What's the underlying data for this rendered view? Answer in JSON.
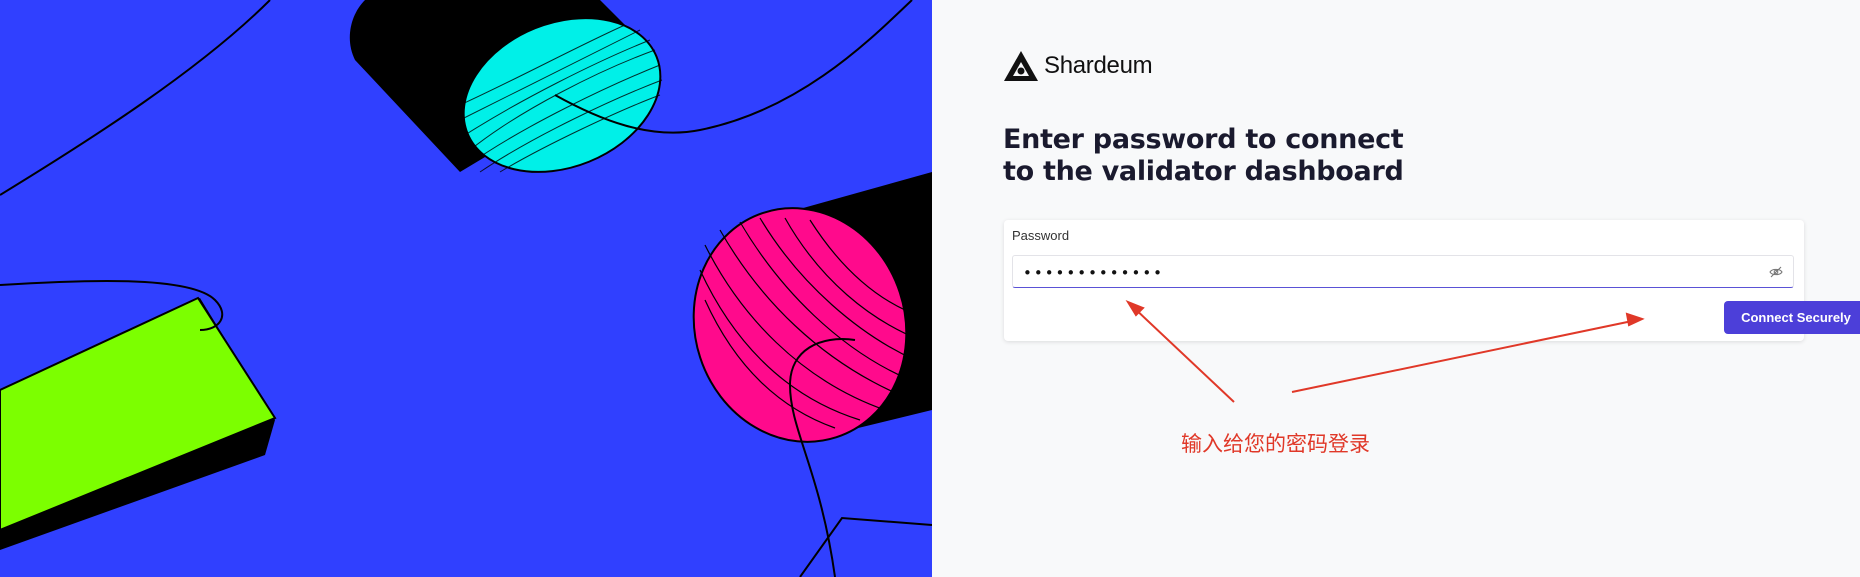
{
  "brand": {
    "name": "Shardeum",
    "accent": "#4c3fd9"
  },
  "login": {
    "heading_line1": "Enter password to connect",
    "heading_line2": "to the validator dashboard",
    "password_label": "Password",
    "password_value": "•••••••••••••",
    "submit_label": "Connect Securely",
    "password_visibility_icon": "eye-off-icon"
  },
  "annotation": {
    "text": "输入给您的密码登录",
    "color": "#e03828"
  },
  "artwork": {
    "background": "#3040ff",
    "shape_colors": [
      "#00f0e8",
      "#ff0a8c",
      "#7cff00",
      "#000000"
    ]
  }
}
